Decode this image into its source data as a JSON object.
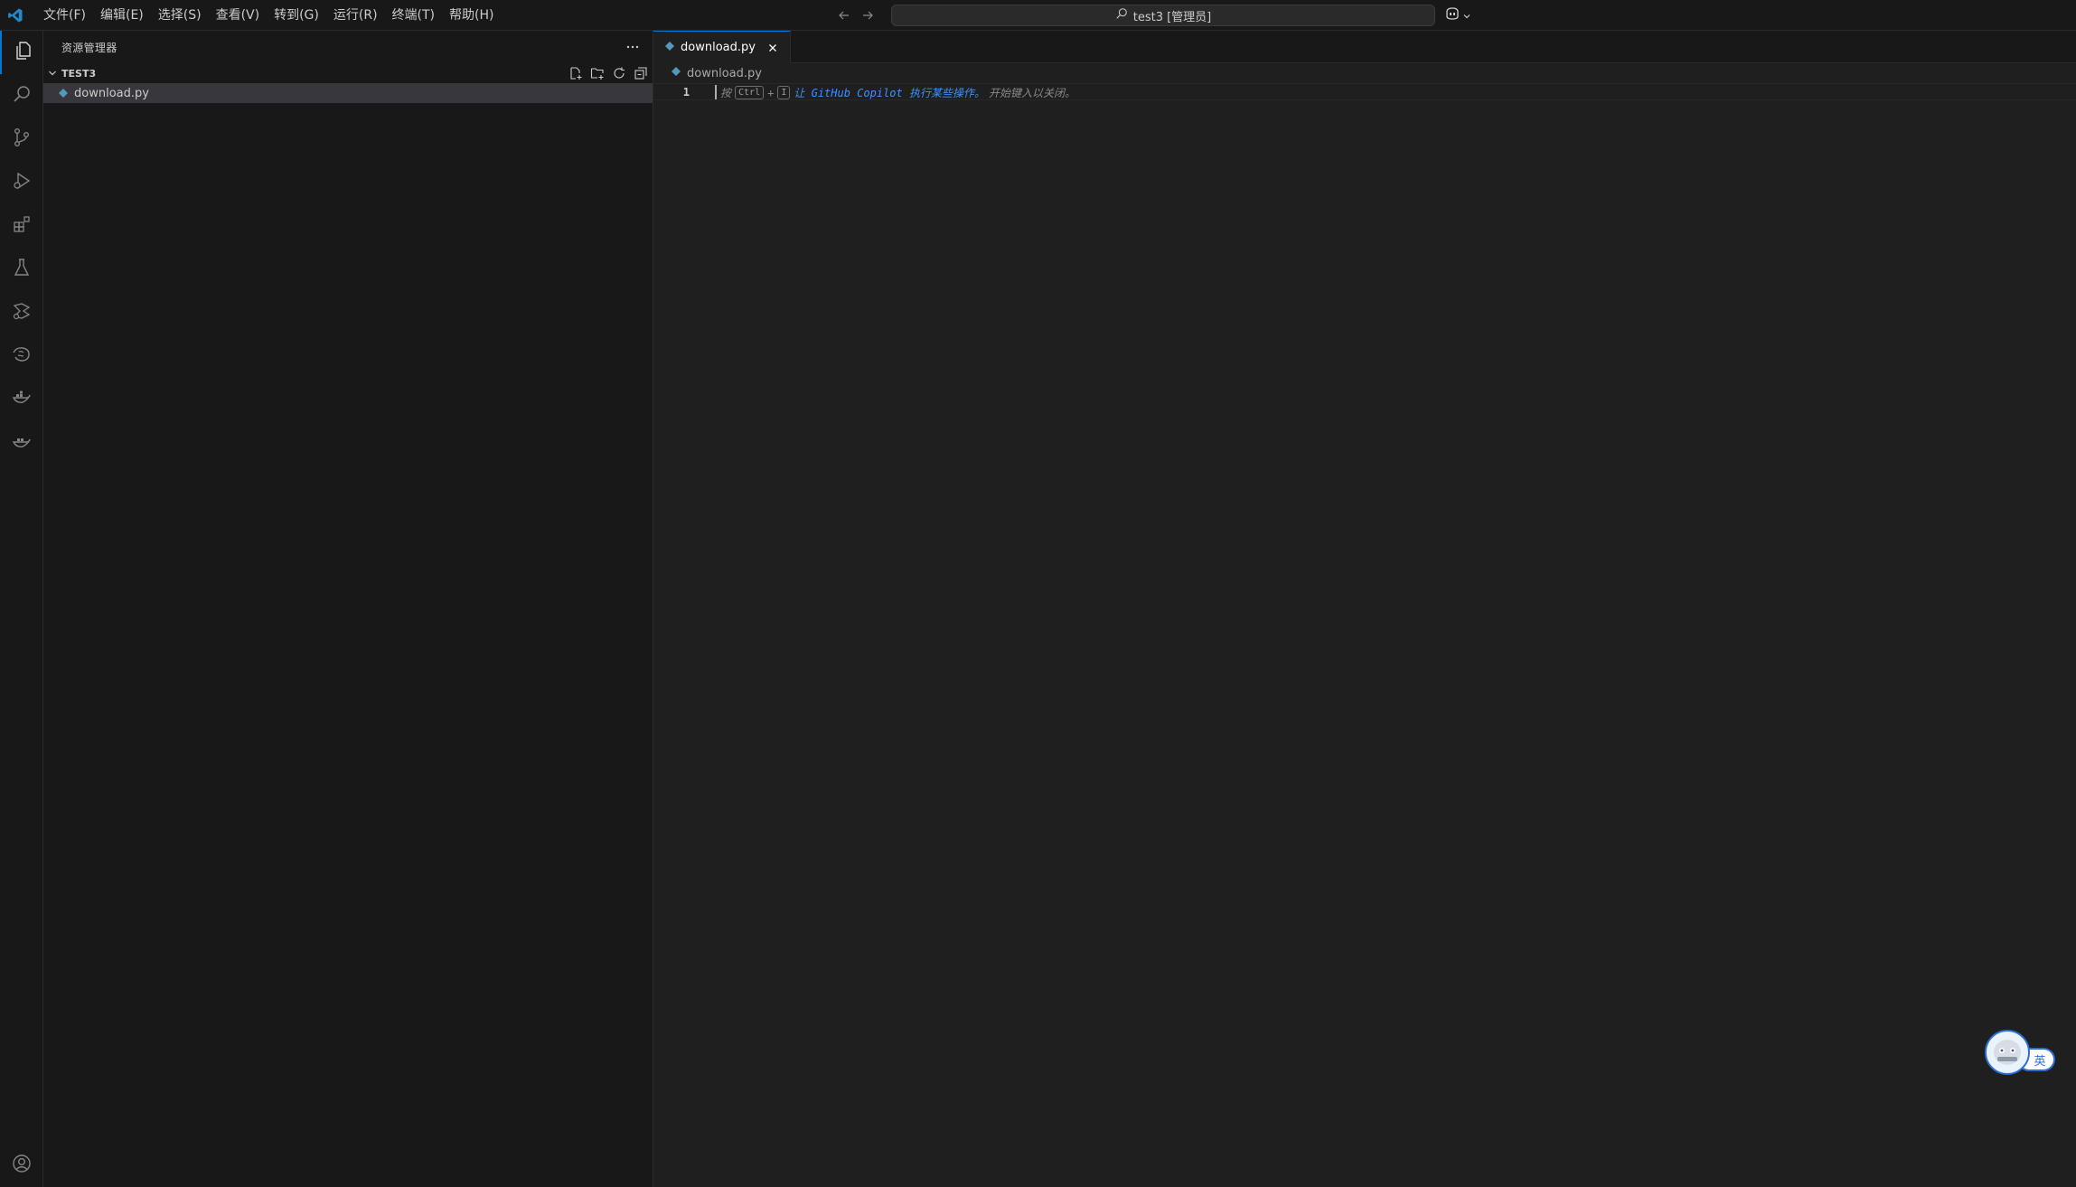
{
  "titlebar": {
    "menu": [
      "文件(F)",
      "编辑(E)",
      "选择(S)",
      "查看(V)",
      "转到(G)",
      "运行(R)",
      "终端(T)",
      "帮助(H)"
    ],
    "search_text": "test3 [管理员]"
  },
  "activitybar": {
    "items": [
      "files-icon",
      "search-icon",
      "source-control-icon",
      "run-debug-icon",
      "extensions-icon",
      "testing-icon",
      "remote-icon",
      "python-env-icon",
      "docker-icon",
      "docker-alt-icon"
    ],
    "bottom": [
      "account-icon"
    ]
  },
  "sidebar": {
    "title": "资源管理器",
    "section_title": "TEST3",
    "files": [
      {
        "name": "download.py",
        "selected": true
      }
    ]
  },
  "editor": {
    "tab_label": "download.py",
    "breadcrumb": "download.py",
    "line_number": "1",
    "hint": {
      "prefix": "按",
      "key1": "Ctrl",
      "plus": "+",
      "key2": "I",
      "link_text": "让 GitHub Copilot 执行某些操作。",
      "suffix": "开始键入以关闭。"
    }
  },
  "ime": {
    "label": "英"
  },
  "colors": {
    "accent": "#0078d4",
    "python_icon": "#519aba",
    "link": "#3794ff"
  }
}
